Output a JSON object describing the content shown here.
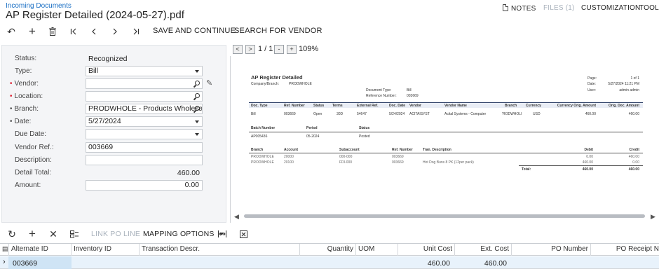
{
  "header": {
    "breadcrumb": "Incoming Documents",
    "title": "AP Register Detailed (2024-05-27).pdf",
    "nav": {
      "notes": "NOTES",
      "files": "FILES (1)",
      "customization": "CUSTOMIZATION",
      "tools": "TOOLS"
    }
  },
  "toolbar": {
    "save_continue": "SAVE AND CONTINUE",
    "search_vendor": "SEARCH FOR VENDOR"
  },
  "form": {
    "status_label": "Status:",
    "status_value": "Recognized",
    "type_label": "Type:",
    "type_value": "Bill",
    "vendor_label": "Vendor:",
    "vendor_value": "",
    "location_label": "Location:",
    "location_value": "",
    "branch_label": "Branch:",
    "branch_value": "PRODWHOLE - Products Wholesale",
    "date_label": "Date:",
    "date_value": "5/27/2024",
    "due_date_label": "Due Date:",
    "due_date_value": "",
    "vendor_ref_label": "Vendor Ref.:",
    "vendor_ref_value": "003669",
    "description_label": "Description:",
    "description_value": "",
    "detail_total_label": "Detail Total:",
    "detail_total_value": "460.00",
    "amount_label": "Amount:",
    "amount_value": "0.00"
  },
  "pdf_viewer": {
    "prev": "<",
    "next": ">",
    "page_indicator": "1 / 1",
    "zoom_out": "-",
    "zoom_in": "+",
    "zoom": "109%"
  },
  "document": {
    "title": "AP Register Detailed",
    "company_label": "Company/Branch:",
    "company_value": "PRODWHOLE",
    "page_label": "Page:",
    "page_value": "1 of 1",
    "date_label": "Date:",
    "date_value": "5/27/2024 11:21 PM",
    "user_label": "User:",
    "user_value": "admin admin",
    "doctype_label": "Document Type:",
    "doctype_value": "Bill",
    "refnum_label": "Reference Number:",
    "refnum_value": "003669",
    "headers": [
      "Doc. Type",
      "Ref. Number",
      "Status",
      "Terms",
      "External Ref.",
      "Doc. Date",
      "Vendor",
      "Vendor Name",
      "Branch",
      "Currency",
      "Currency Orig. Amount",
      "Orig. Doc. Amount"
    ],
    "row": [
      "Bill",
      "003669",
      "Open",
      "30D",
      "54647",
      "5/24/2024",
      "ACITAISYST",
      "Acital Systems - Computer",
      "'RODWHOLI",
      "USD",
      "460.00",
      "460.00"
    ],
    "batch_headers": [
      "Batch Number",
      "Period",
      "Status"
    ],
    "batch_row": [
      "AP005436",
      "05-2024",
      "Posted"
    ],
    "line_headers": [
      "Branch",
      "Account",
      "Subaccount",
      "Ref. Number",
      "Tran. Description",
      "Debit",
      "Credit"
    ],
    "lines": [
      [
        "PRODWHOLE",
        "20000",
        "000-000",
        "003669",
        "",
        "0.00",
        "460.00"
      ],
      [
        "PRODWHOLE",
        "20100",
        "FDI-000",
        "003669",
        "Hot Dog Buns 8 PK (12per pack)",
        "460.00",
        "0.00"
      ]
    ],
    "total_label": "Total:",
    "total_debit": "460.00",
    "total_credit": "460.00"
  },
  "grid_toolbar": {
    "link_po_line": "LINK PO LINE",
    "mapping_options": "MAPPING OPTIONS"
  },
  "grid": {
    "columns": {
      "alternate_id": "Alternate ID",
      "inventory_id": "Inventory ID",
      "transaction_descr": "Transaction Descr.",
      "quantity": "Quantity",
      "uom": "UOM",
      "unit_cost": "Unit Cost",
      "ext_cost": "Ext. Cost",
      "po_number": "PO Number",
      "po_receipt": "PO Receipt N"
    },
    "row": {
      "alternate_id": "003669",
      "unit_cost": "460.00",
      "ext_cost": "460.00"
    }
  }
}
